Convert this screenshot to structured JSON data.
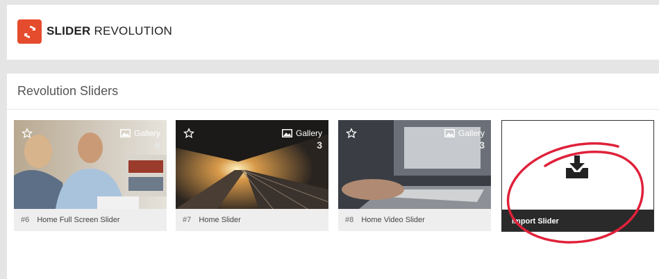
{
  "header": {
    "brand_bold": "SLIDER",
    "brand_light": "REVOLUTION",
    "logo_icon": "refresh-icon",
    "logo_color": "#e54c2d"
  },
  "panel": {
    "title": "Revolution Sliders"
  },
  "sliders": [
    {
      "id": "#6",
      "name": "Home Full Screen Slider",
      "type": "Gallery",
      "count": "6"
    },
    {
      "id": "#7",
      "name": "Home Slider",
      "type": "Gallery",
      "count": "3"
    },
    {
      "id": "#8",
      "name": "Home Video Slider",
      "type": "Gallery",
      "count": "3"
    }
  ],
  "import": {
    "label": "Import Slider",
    "icon": "download-tray-icon"
  },
  "annotation": {
    "color": "#e0213a"
  }
}
